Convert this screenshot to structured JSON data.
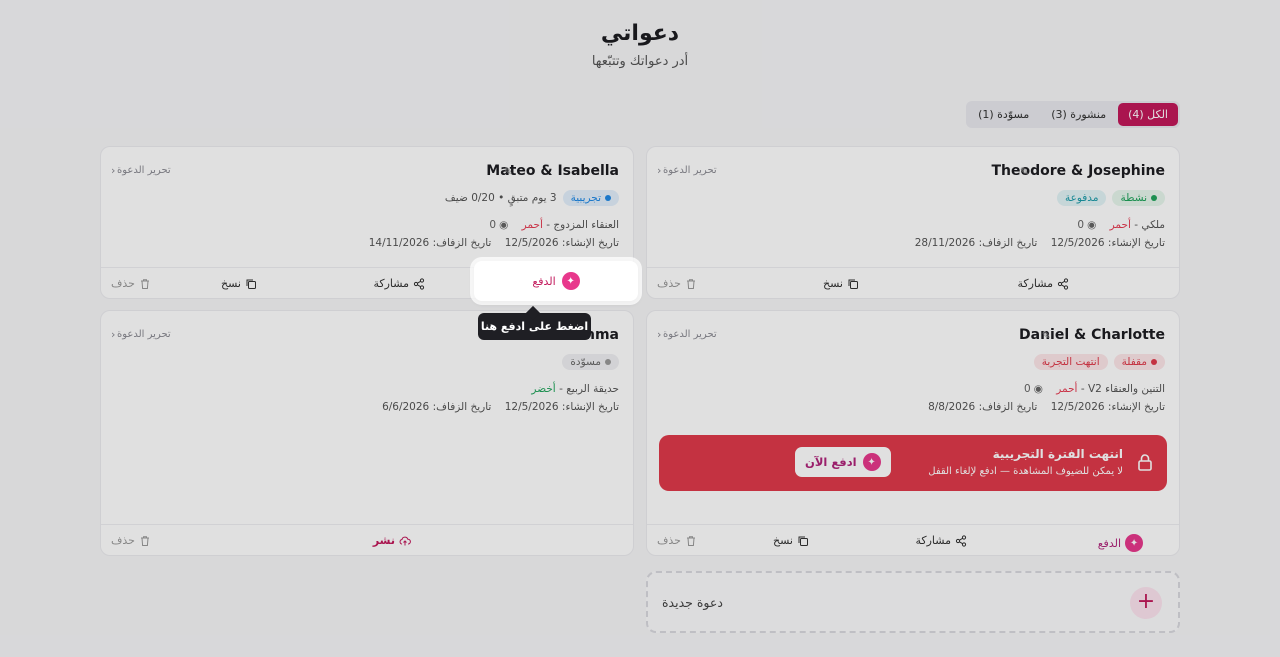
{
  "page": {
    "title": "دعواتي",
    "subtitle": "أدر دعواتك وتتبّعها"
  },
  "tabs": [
    {
      "label": "الكل (4)",
      "active": true
    },
    {
      "label": "منشورة (3)",
      "active": false
    },
    {
      "label": "مسوّدة (1)",
      "active": false
    }
  ],
  "cards": {
    "theodore": {
      "title": "Theodore & Josephine",
      "edit_label": "تحرير الدعوة",
      "status": "نشطة",
      "payment": "مدفوعة",
      "template": "ملكي",
      "color": "أحمر",
      "views": "0",
      "created": "تاريخ الإنشاء: 12/5/2026",
      "wedding": "تاريخ الزفاف: 28/11/2026",
      "share": "مشاركة",
      "copy": "نسخ",
      "delete": "حذف"
    },
    "mateo": {
      "title": "Mateo & Isabella",
      "edit_label": "تحرير الدعوة",
      "status": "تجريبية",
      "trial_info": "3 يوم متبقٍ • 0/20 ضيف",
      "template": "العنقاء المزدوج",
      "color": "أحمر",
      "views": "0",
      "created": "تاريخ الإنشاء: 12/5/2026",
      "wedding": "تاريخ الزفاف: 14/11/2026",
      "pay": "الدفع",
      "share": "مشاركة",
      "copy": "نسخ",
      "delete": "حذف"
    },
    "daniel": {
      "title": "Daniel & Charlotte",
      "edit_label": "تحرير الدعوة",
      "status": "مقفلة",
      "trial_badge": "انتهت التجربة",
      "template": "التنين والعنقاء V2",
      "color": "أحمر",
      "views": "0",
      "created": "تاريخ الإنشاء: 12/5/2026",
      "wedding": "تاريخ الزفاف: 8/8/2026",
      "locked_title": "انتهت الفترة التجريبية",
      "locked_sub": "لا يمكن للضيوف المشاهدة — ادفع لإلغاء القفل",
      "pay_now": "ادفع الآن",
      "pay": "الدفع",
      "share": "مشاركة",
      "copy": "نسخ",
      "delete": "حذف"
    },
    "draft": {
      "title": "mma",
      "edit_label": "تحرير الدعوة",
      "status": "مسوّدة",
      "template": "حديقة الربيع",
      "color": "أخضر",
      "created": "تاريخ الإنشاء: 12/5/2026",
      "wedding": "تاريخ الزفاف: 6/6/2026",
      "publish": "نشر",
      "delete": "حذف"
    }
  },
  "new_invite": "دعوة جديدة",
  "spotlight": {
    "label": "الدفع",
    "tooltip": "اضغط على ادفع هنا"
  },
  "colors": {
    "brand": "#c2185b",
    "active_green": "#1fa35a",
    "paid_teal": "#1a9aa8",
    "danger": "#e03a4a",
    "trial_blue": "#1e88e5"
  }
}
